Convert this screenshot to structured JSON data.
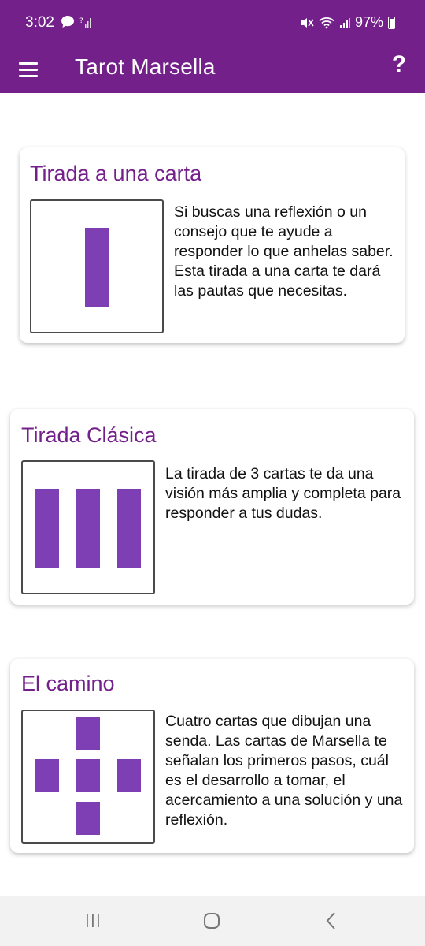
{
  "status_bar": {
    "time": "3:02",
    "battery": "97%",
    "icons": [
      "chat-bubble-icon",
      "no-sim-signal-icon",
      "mute-icon",
      "wifi-icon",
      "signal-icon",
      "battery-charging-icon"
    ]
  },
  "app_bar": {
    "title": "Tarot Marsella",
    "help_label": "?",
    "menu_icon": "hamburger-menu-icon"
  },
  "spreads": [
    {
      "title": "Tirada a una carta",
      "description": "Si buscas una reflexión o un consejo que te ayude a responder lo que anhelas saber. Esta tirada a una carta te dará las pautas que necesitas.",
      "icon": "one-card-spread-icon"
    },
    {
      "title": "Tirada Clásica",
      "description": "La tirada de 3 cartas te da una visión más amplia y completa para responder a tus dudas.",
      "icon": "three-card-spread-icon"
    },
    {
      "title": "El camino",
      "description": "Cuatro cartas que dibujan una senda. Las cartas de Marsella te señalan los primeros pasos, cuál es el desarrollo a tomar, el acercamiento a una solución y una reflexión.",
      "icon": "cross-spread-icon"
    }
  ],
  "colors": {
    "primary": "#74208b",
    "card_fill": "#7f3fb4",
    "nav_bar": "#f2f2f2"
  },
  "nav_bar": {
    "buttons": [
      "recent-apps-icon",
      "home-icon",
      "back-icon"
    ]
  }
}
